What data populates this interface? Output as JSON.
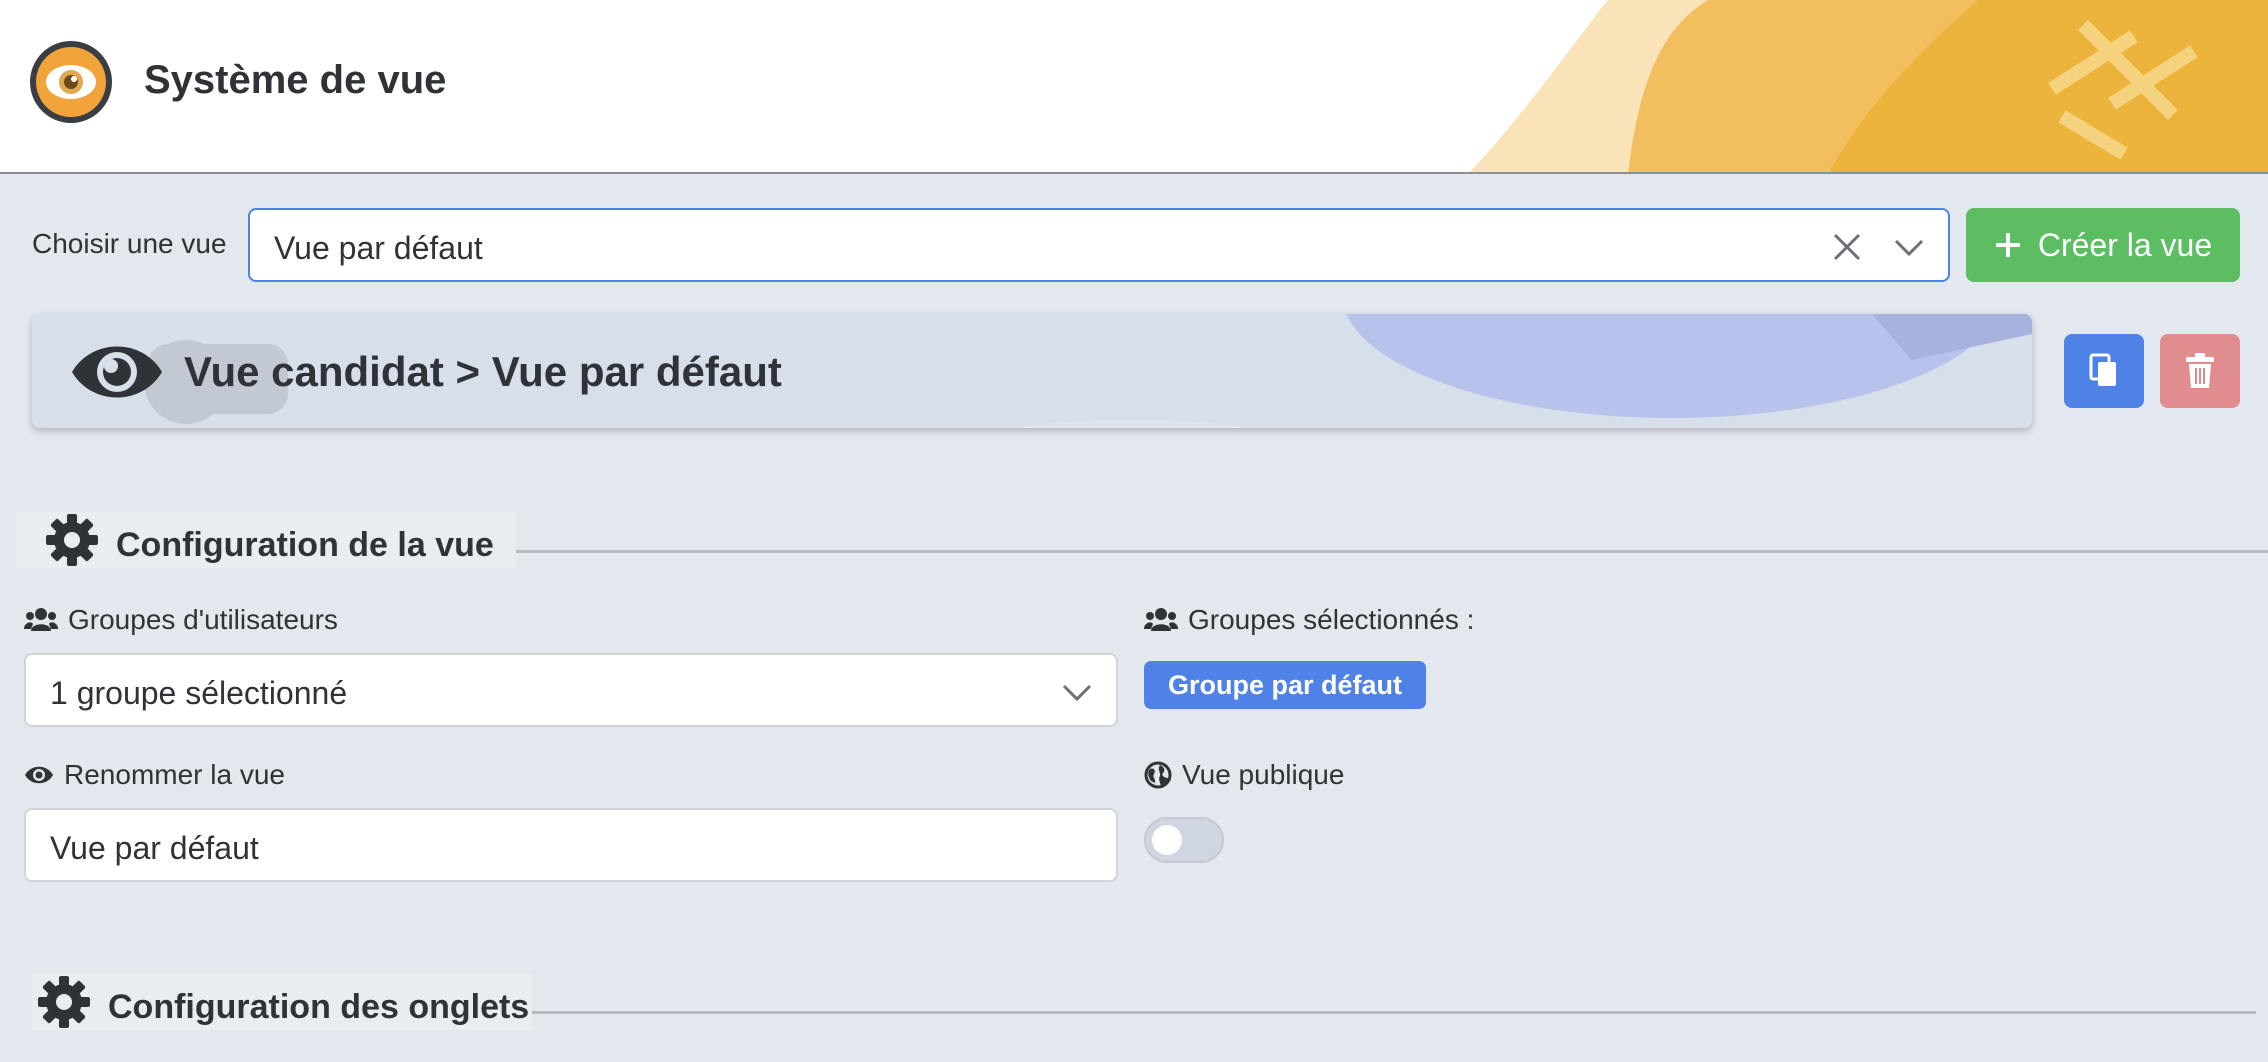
{
  "header": {
    "title": "Système de vue",
    "logo_icon": "eye-logo-icon",
    "accent_color": "#f0a43a"
  },
  "chooser": {
    "label": "Choisir une vue",
    "selected_value": "Vue par défaut",
    "clear_icon": "close-icon",
    "chevron_icon": "chevron-down-icon",
    "create_button_label": "Créer la vue",
    "create_button_color": "#5cbd63"
  },
  "view_card": {
    "title": "Vue candidat > Vue par défaut",
    "icon": "eye-icon",
    "copy_icon": "copy-icon",
    "delete_icon": "trash-icon",
    "copy_color": "#4f82e6",
    "delete_color": "#e18d8f"
  },
  "section_view_config": {
    "title": "Configuration de la vue",
    "icon": "gear-icon"
  },
  "form": {
    "user_groups_label": "Groupes d'utilisateurs",
    "user_groups_value": "1 groupe sélectionné",
    "selected_groups_label": "Groupes sélectionnés :",
    "selected_groups": [
      "Groupe par défaut"
    ],
    "rename_label": "Renommer la vue",
    "rename_value": "Vue par défaut",
    "public_label": "Vue publique",
    "public_enabled": false
  },
  "section_tabs_config": {
    "title": "Configuration des onglets",
    "icon": "gear-icon"
  }
}
